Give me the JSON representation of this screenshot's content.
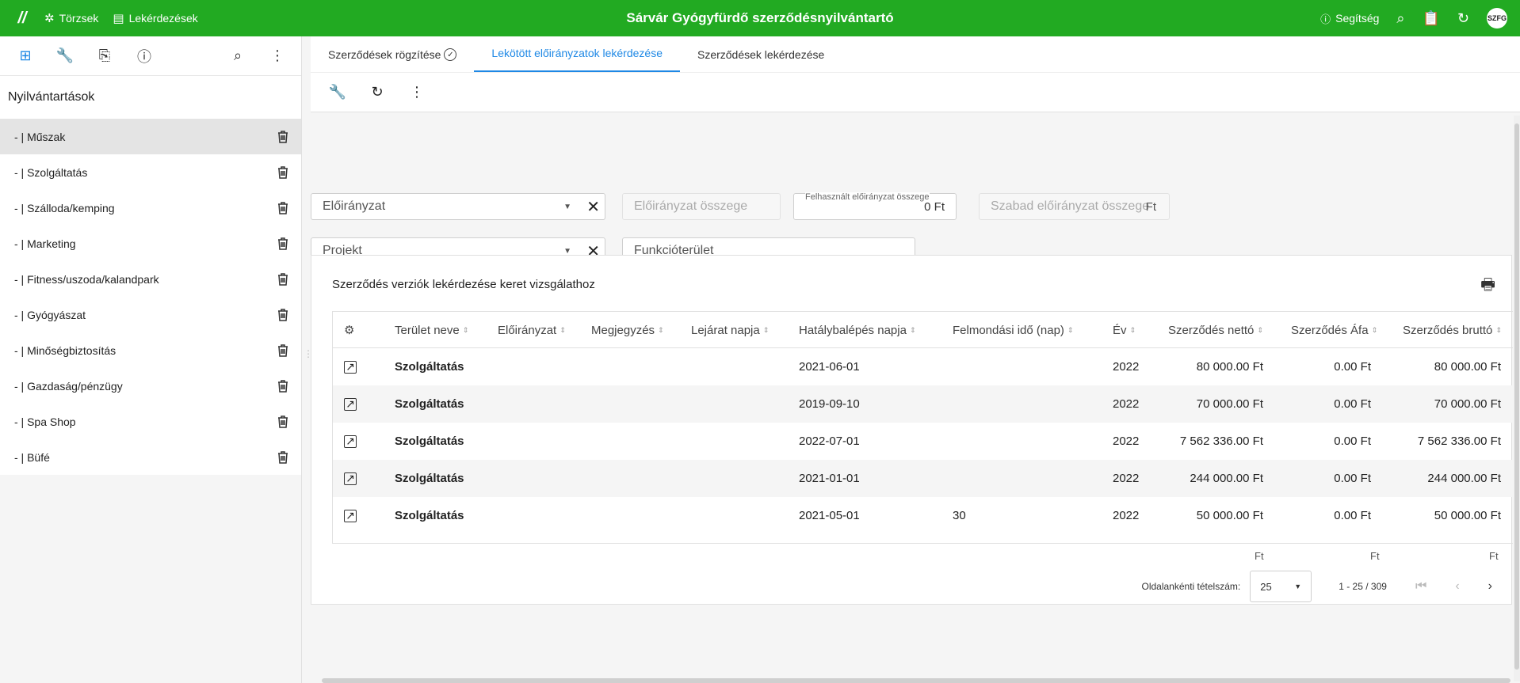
{
  "topbar": {
    "logo": "//",
    "nav_torzsek": "Törzsek",
    "nav_lekerdezesek": "Lekérdezések",
    "title": "Sárvár Gyógyfürdő szerződésnyilvántartó",
    "help": "Segítség",
    "avatar": "SZFG"
  },
  "sidebar": {
    "heading": "Nyilvántartások",
    "items": [
      {
        "label": "- | Műszak"
      },
      {
        "label": "- | Szolgáltatás"
      },
      {
        "label": "- | Szálloda/kemping"
      },
      {
        "label": "- | Marketing"
      },
      {
        "label": "- | Fitness/uszoda/kalandpark"
      },
      {
        "label": "- | Gyógyászat"
      },
      {
        "label": "- | Minőségbiztosítás"
      },
      {
        "label": "- | Gazdaság/pénzügy"
      },
      {
        "label": "- | Spa Shop"
      },
      {
        "label": "- | Büfé"
      }
    ]
  },
  "tabs": [
    {
      "label": "Szerződések rögzítése"
    },
    {
      "label": "Lekötött előirányzatok lekérdezése"
    },
    {
      "label": "Szerződések lekérdezése"
    }
  ],
  "filters": {
    "eloiranyzat_placeholder": "Előirányzat",
    "eloiranyzat_osszege_placeholder": "Előirányzat összege",
    "felhasznalt_label": "Felhasznált előirányzat összege",
    "felhasznalt_value": "0 Ft",
    "szabad_placeholder": "Szabad előirányzat összege",
    "szabad_suffix": "Ft",
    "projekt_placeholder": "Projekt",
    "funkcioterulet_placeholder": "Funkcióterület"
  },
  "card": {
    "title": "Szerződés verziók lekérdezése keret vizsgálathoz"
  },
  "grid": {
    "headers": {
      "terulet": "Terület neve",
      "eloiranyzat": "Előirányzat",
      "megjegyzes": "Megjegyzés",
      "lejarat": "Lejárat napja",
      "hatalybalepes": "Hatálybalépés napja",
      "felmondasi": "Felmondási idő (nap)",
      "ev": "Év",
      "netto": "Szerződés nettó",
      "afa": "Szerződés Áfa",
      "brutto": "Szerződés bruttó"
    },
    "rows": [
      {
        "terulet": "Szolgáltatás",
        "hatalybalepes": "2021-06-01",
        "felmondasi": "",
        "ev": "2022",
        "netto": "80 000.00 Ft",
        "afa": "0.00 Ft",
        "brutto": "80 000.00 Ft"
      },
      {
        "terulet": "Szolgáltatás",
        "hatalybalepes": "2019-09-10",
        "felmondasi": "",
        "ev": "2022",
        "netto": "70 000.00 Ft",
        "afa": "0.00 Ft",
        "brutto": "70 000.00 Ft"
      },
      {
        "terulet": "Szolgáltatás",
        "hatalybalepes": "2022-07-01",
        "felmondasi": "",
        "ev": "2022",
        "netto": "7 562 336.00 Ft",
        "afa": "0.00 Ft",
        "brutto": "7 562 336.00 Ft"
      },
      {
        "terulet": "Szolgáltatás",
        "hatalybalepes": "2021-01-01",
        "felmondasi": "",
        "ev": "2022",
        "netto": "244 000.00 Ft",
        "afa": "0.00 Ft",
        "brutto": "244 000.00 Ft"
      },
      {
        "terulet": "Szolgáltatás",
        "hatalybalepes": "2021-05-01",
        "felmondasi": "30",
        "ev": "2022",
        "netto": "50 000.00 Ft",
        "afa": "0.00 Ft",
        "brutto": "50 000.00 Ft"
      }
    ],
    "footer_netto": "Ft",
    "footer_afa": "Ft",
    "footer_brutto": "Ft"
  },
  "pager": {
    "label": "Oldalankénti tételszám:",
    "page_size": "25",
    "range": "1 - 25 / 309"
  }
}
